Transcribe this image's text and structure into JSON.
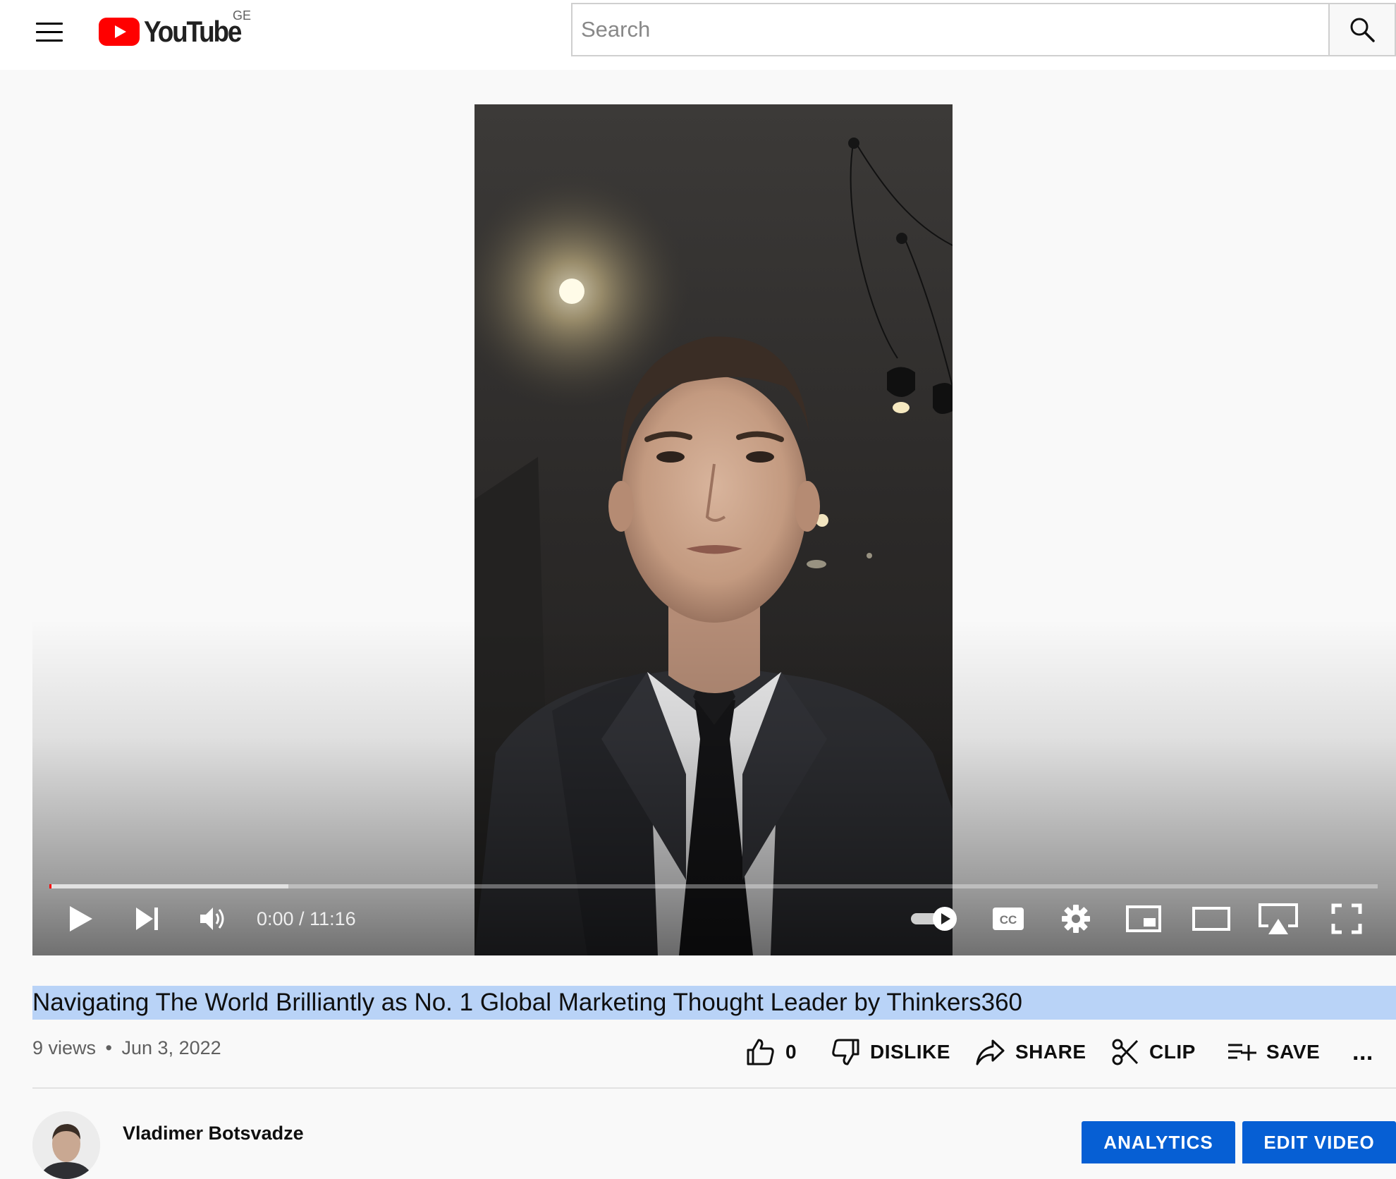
{
  "header": {
    "logo_text": "YouTube",
    "country_code": "GE",
    "search_placeholder": "Search"
  },
  "player": {
    "time_display": "0:00 / 11:16",
    "current_time": "0:00",
    "duration": "11:16",
    "buffered_fraction": 0.18,
    "autoplay": "on"
  },
  "video": {
    "title": "Navigating The World Brilliantly as No. 1 Global Marketing Thought Leader by Thinkers360",
    "views": "9 views",
    "separator": "•",
    "date": "Jun 3, 2022"
  },
  "actions": {
    "like_count": "0",
    "dislike_label": "DISLIKE",
    "share_label": "SHARE",
    "clip_label": "CLIP",
    "save_label": "SAVE",
    "more_label": "..."
  },
  "channel": {
    "name": "Vladimer Botsvadze",
    "analytics_label": "ANALYTICS",
    "edit_video_label": "EDIT VIDEO"
  },
  "colors": {
    "brand_red": "#ff0000",
    "primary_blue": "#065fd4",
    "selection_highlight": "#b9d3f7"
  },
  "icons": [
    "menu-icon",
    "youtube-play-icon",
    "search-icon",
    "play-icon",
    "next-icon",
    "volume-icon",
    "autoplay-toggle",
    "subtitles-icon",
    "settings-icon",
    "miniplayer-icon",
    "theater-icon",
    "airplay-icon",
    "fullscreen-icon",
    "thumbs-up-icon",
    "thumbs-down-icon",
    "share-icon",
    "scissors-icon",
    "playlist-add-icon",
    "more-icon"
  ]
}
